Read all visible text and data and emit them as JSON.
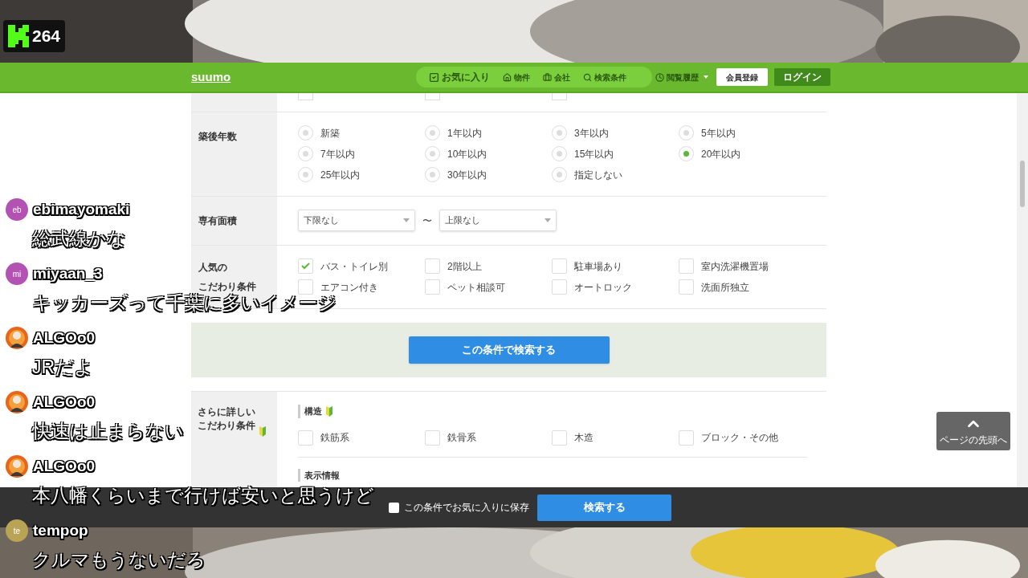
{
  "stream": {
    "viewer_count": "264"
  },
  "header": {
    "logo": "suumo",
    "nav": [
      {
        "label": "お気に入り",
        "kind": "favorite"
      },
      {
        "label": "物件",
        "kind": "property"
      },
      {
        "label": "会社",
        "kind": "company"
      },
      {
        "label": "検索条件",
        "kind": "search"
      }
    ],
    "history": "閲覧履歴",
    "register": "会員登録",
    "login": "ログイン"
  },
  "form": {
    "partial_row": [
      {
        "checked": false
      },
      {
        "checked": false
      },
      {
        "checked": false
      }
    ],
    "rows": [
      {
        "label": [
          "築後年数"
        ],
        "kind": "radio",
        "options": [
          {
            "label": "新築",
            "selected": false
          },
          {
            "label": "1年以内",
            "selected": false
          },
          {
            "label": "3年以内",
            "selected": false
          },
          {
            "label": "5年以内",
            "selected": false
          },
          {
            "label": "7年以内",
            "selected": false
          },
          {
            "label": "10年以内",
            "selected": false
          },
          {
            "label": "15年以内",
            "selected": false
          },
          {
            "label": "20年以内",
            "selected": true
          },
          {
            "label": "25年以内",
            "selected": false
          },
          {
            "label": "30年以内",
            "selected": false
          },
          {
            "label": "指定しない",
            "selected": false
          }
        ]
      },
      {
        "label": [
          "専有面積"
        ],
        "kind": "range",
        "from": "下限なし",
        "separator": "〜",
        "to": "上限なし"
      },
      {
        "label": [
          "人気の",
          "こだわり条件"
        ],
        "kind": "checkbox",
        "options": [
          {
            "label": "バス・トイレ別",
            "checked": true
          },
          {
            "label": "2階以上",
            "checked": false
          },
          {
            "label": "駐車場あり",
            "checked": false
          },
          {
            "label": "室内洗濯機置場",
            "checked": false
          },
          {
            "label": "エアコン付き",
            "checked": false
          },
          {
            "label": "ペット相談可",
            "checked": false
          },
          {
            "label": "オートロック",
            "checked": false
          },
          {
            "label": "洗面所独立",
            "checked": false
          }
        ]
      }
    ]
  },
  "search_panel": {
    "button": "この条件で検索する"
  },
  "details": {
    "label": [
      "さらに詳しい",
      "こだわり条件"
    ],
    "sections": [
      {
        "title": "構造",
        "options": [
          {
            "label": "鉄筋系",
            "checked": false
          },
          {
            "label": "鉄骨系",
            "checked": false
          },
          {
            "label": "木造",
            "checked": false
          },
          {
            "label": "ブロック・その他",
            "checked": false
          }
        ]
      },
      {
        "title": "表示情報"
      }
    ]
  },
  "page_top": "ページの先頭へ",
  "bottom_bar": {
    "save": {
      "label": "この条件でお気に入りに保存",
      "checked": false
    },
    "button": "検索する"
  },
  "chat": [
    {
      "name": "ebimayomaki",
      "kind": "initials",
      "initials": "eb",
      "color": "#b452b4",
      "message": "総武線かな"
    },
    {
      "name": "miyaan_3",
      "kind": "initials",
      "initials": "mi",
      "color": "#b452b4",
      "message": "キッカーズって千葉に多いイメージ"
    },
    {
      "name": "ALGOo0",
      "kind": "picture",
      "message": "JRだよ"
    },
    {
      "name": "ALGOo0",
      "kind": "picture",
      "message": "快速は止まらない"
    },
    {
      "name": "ALGOo0",
      "kind": "picture",
      "message": "本八幡くらいまで行けば安いと思うけど"
    },
    {
      "name": "tempop",
      "kind": "initials",
      "initials": "te",
      "color": "#b9a456",
      "message": "クルマもうないだろ"
    }
  ]
}
